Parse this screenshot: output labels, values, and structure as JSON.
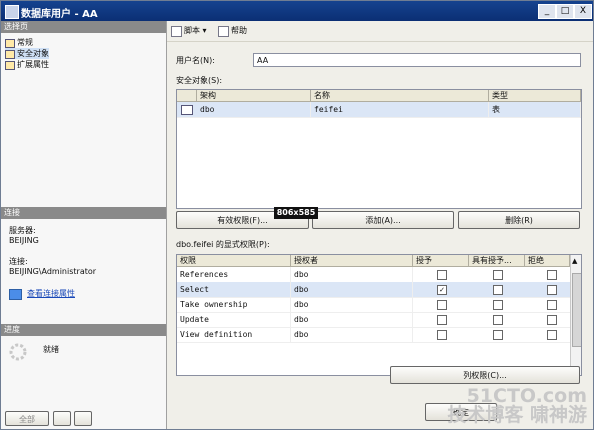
{
  "window": {
    "title": "数据库用户 - AA",
    "controls": [
      "_",
      "□",
      "X"
    ]
  },
  "left": {
    "select_page_header": "选择页",
    "pages": [
      "常规",
      "安全对象",
      "扩展属性"
    ],
    "selected_page": 1,
    "connection_header": "连接",
    "server_label": "服务器:",
    "server_value": "BEIJING",
    "connection_label": "连接:",
    "connection_value": "BEIJING\\Administrator",
    "view_connection_link": "查看连接属性",
    "progress_header": "进度",
    "progress_status": "就绪"
  },
  "toolbar": {
    "script_label": "脚本",
    "help_label": "帮助"
  },
  "form": {
    "username_label": "用户名(N):",
    "username_value": "AA",
    "securables_label": "安全对象(S):",
    "securables_columns": [
      "架构",
      "名称",
      "类型"
    ],
    "securables_rows": [
      {
        "schema": "dbo",
        "name": "feifei",
        "type": "表"
      }
    ],
    "effective_button": "有效权限(F)...",
    "add_button": "添加(A)...",
    "remove_button": "删除(R)",
    "explicit_label": "dbo.feifei 的显式权限(P):",
    "perm_columns": [
      "权限",
      "授权者",
      "授予",
      "具有授予...",
      "拒绝"
    ],
    "permissions": [
      {
        "name": "References",
        "grantor": "dbo",
        "grant": "",
        "with_grant": "",
        "deny": ""
      },
      {
        "name": "Select",
        "grantor": "dbo",
        "grant": "✓",
        "with_grant": "",
        "deny": ""
      },
      {
        "name": "Take ownership",
        "grantor": "dbo",
        "grant": "",
        "with_grant": "",
        "deny": ""
      },
      {
        "name": "Update",
        "grantor": "dbo",
        "grant": "",
        "with_grant": "",
        "deny": ""
      },
      {
        "name": "View definition",
        "grantor": "dbo",
        "grant": "",
        "with_grant": "",
        "deny": ""
      }
    ],
    "column_permissions_button": "列权限(C)...",
    "ok_button": "确定"
  },
  "overlay": {
    "size_badge": "806x585"
  },
  "watermark": {
    "line1": "51CTO.com",
    "line2": "技术博客 啸神游"
  },
  "colors": {
    "title_bar": "#0b2f74",
    "selection": "#dbe6f6",
    "link": "#1948b8"
  }
}
